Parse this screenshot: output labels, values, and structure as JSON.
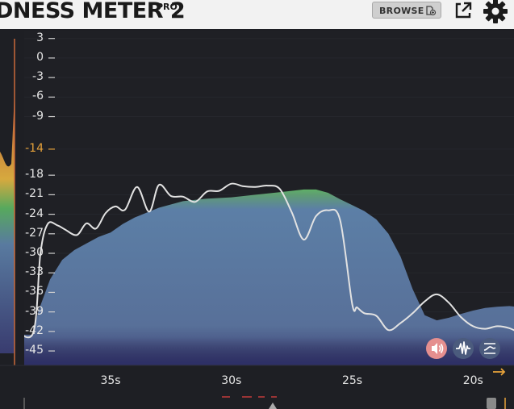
{
  "header": {
    "title": "DNESS METER 2",
    "badge": "PRO",
    "browse_label": "BROWSE"
  },
  "icons": {
    "browse": "folder-add-icon",
    "popout": "external-link-icon",
    "settings": "gear-icon",
    "speaker": "speaker-icon",
    "waveform": "waveform-icon",
    "curve": "curve-icon",
    "arrow": "arrow-right-icon"
  },
  "colors": {
    "background": "#1e1f24",
    "fill": "#5c7bab",
    "fill_top_green": "#58b55a",
    "target": "#e8a33a",
    "line": "#e0e0e0",
    "speaker_active": "#e98c8c"
  },
  "chart_data": {
    "type": "area",
    "title": "",
    "xlabel": "",
    "ylabel": "",
    "ylim": [
      -47,
      3
    ],
    "y_ticks": [
      "3",
      "0",
      "-3",
      "-6",
      "-9",
      "-14",
      "-18",
      "-21",
      "-24",
      "-27",
      "-30",
      "-33",
      "-36",
      "-39",
      "-42",
      "-45"
    ],
    "target_tick": "-14",
    "x_ticks": [
      "35s",
      "30s",
      "25s",
      "20s"
    ],
    "x_tick_values": [
      35,
      30,
      25,
      20
    ],
    "xlim": [
      39,
      17.5
    ],
    "series": [
      {
        "role": "filled-area",
        "x": [
          39,
          38.2,
          38.0,
          37.5,
          37.0,
          36.5,
          36.0,
          35.5,
          35.0,
          34.5,
          34.0,
          33.0,
          32.0,
          31.0,
          30.0,
          29.0,
          28.0,
          27.0,
          26.5,
          26.0,
          25.5,
          25.0,
          24.5,
          24.0,
          23.5,
          23.0,
          22.5,
          22.0,
          21.5,
          21.0,
          20.5,
          20.0,
          19.5,
          19.0,
          18.5,
          18.0,
          17.5
        ],
        "y": [
          -42.5,
          -42.5,
          -39,
          -34,
          -31,
          -29.5,
          -28.5,
          -27.5,
          -26.8,
          -25.5,
          -24.5,
          -23,
          -22,
          -21.6,
          -21.4,
          -21,
          -20.6,
          -20.2,
          -20.2,
          -20.7,
          -21.7,
          -22.6,
          -23.5,
          -24.8,
          -27,
          -30.5,
          -35.5,
          -39.5,
          -40.3,
          -39.9,
          -39.3,
          -38.8,
          -38.4,
          -38.2,
          -38.1,
          -38.3,
          -38.5
        ]
      },
      {
        "role": "momentary-line",
        "x": [
          39,
          38.2,
          37.9,
          37.6,
          37.2,
          36.9,
          36.4,
          36.0,
          35.6,
          35.2,
          34.8,
          34.4,
          33.9,
          33.4,
          33.0,
          32.5,
          32.0,
          31.5,
          31.0,
          30.5,
          30.0,
          29.5,
          29.0,
          28.5,
          28.0,
          27.5,
          27.0,
          26.5,
          26.0,
          25.5,
          25.0,
          24.8,
          24.5,
          24.0,
          23.5,
          23.0,
          22.5,
          22.0,
          21.5,
          21.0,
          20.5,
          20.0,
          19.5,
          19.0,
          18.5,
          18.0,
          17.5
        ],
        "y": [
          -41.5,
          -42.2,
          -30,
          -25.5,
          -25.7,
          -26.3,
          -27.2,
          -25.4,
          -26.2,
          -23.8,
          -22.8,
          -23.3,
          -19.8,
          -23.6,
          -19.5,
          -21.2,
          -21.3,
          -22.1,
          -20.5,
          -20.4,
          -19.3,
          -19.7,
          -19.8,
          -19.6,
          -20.1,
          -23.7,
          -27.9,
          -24.3,
          -23.4,
          -24.9,
          -37.8,
          -38.3,
          -39.2,
          -39.6,
          -41.8,
          -40.7,
          -39.2,
          -37.4,
          -36.3,
          -37.6,
          -39.8,
          -41.2,
          -41.6,
          -41.2,
          -41.5,
          -42.3,
          -42.4
        ]
      }
    ],
    "grid": true,
    "legend": "none"
  }
}
